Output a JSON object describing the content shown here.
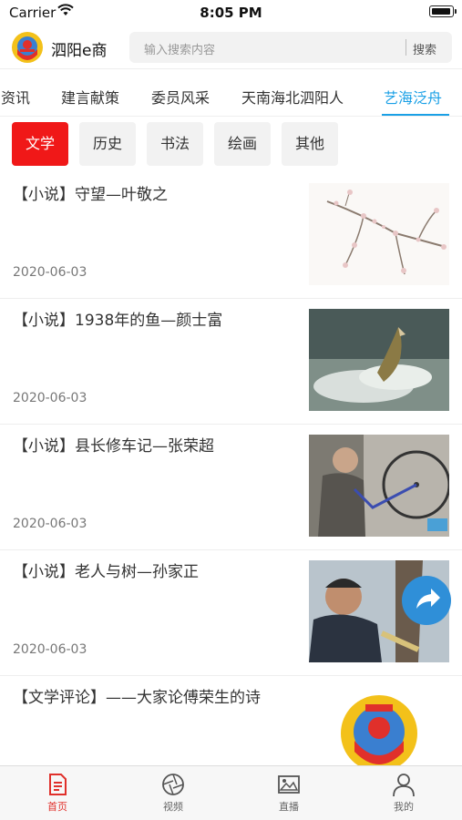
{
  "status": {
    "carrier": "Carrier",
    "time": "8:05 PM"
  },
  "header": {
    "app_name": "泗阳e商",
    "search_placeholder": "输入搜索内容",
    "search_button": "搜索"
  },
  "tabs": [
    {
      "label": "泗阳资讯"
    },
    {
      "label": "建言献策"
    },
    {
      "label": "委员风采"
    },
    {
      "label": "天南海北泗阳人"
    },
    {
      "label": "艺海泛舟",
      "active": true
    }
  ],
  "chips": [
    {
      "label": "文学",
      "active": true
    },
    {
      "label": "历史"
    },
    {
      "label": "书法"
    },
    {
      "label": "绘画"
    },
    {
      "label": "其他"
    }
  ],
  "articles": [
    {
      "title": "【小说】守望—叶敬之",
      "date": "2020-06-03",
      "thumb": "blossom-branch-image"
    },
    {
      "title": "【小说】1938年的鱼—颜士富",
      "date": "2020-06-03",
      "thumb": "leaping-fish-image"
    },
    {
      "title": "【小说】县长修车记—张荣超",
      "date": "2020-06-03",
      "thumb": "bicycle-repair-image"
    },
    {
      "title": "【小说】老人与树—孙家正",
      "date": "2020-06-03",
      "thumb": "old-man-tree-image"
    },
    {
      "title": "【文学评论】——大家论傅荣生的诗",
      "date": "",
      "thumb": "cppcc-emblem-image"
    }
  ],
  "tabbar": [
    {
      "label": "首页",
      "icon": "document-icon",
      "active": true
    },
    {
      "label": "视频",
      "icon": "aperture-icon"
    },
    {
      "label": "直播",
      "icon": "picture-icon"
    },
    {
      "label": "我的",
      "icon": "person-icon"
    }
  ],
  "colors": {
    "accent_blue": "#1aa0e6",
    "chip_red": "#f01818",
    "tab_active_red": "#e0302b"
  }
}
